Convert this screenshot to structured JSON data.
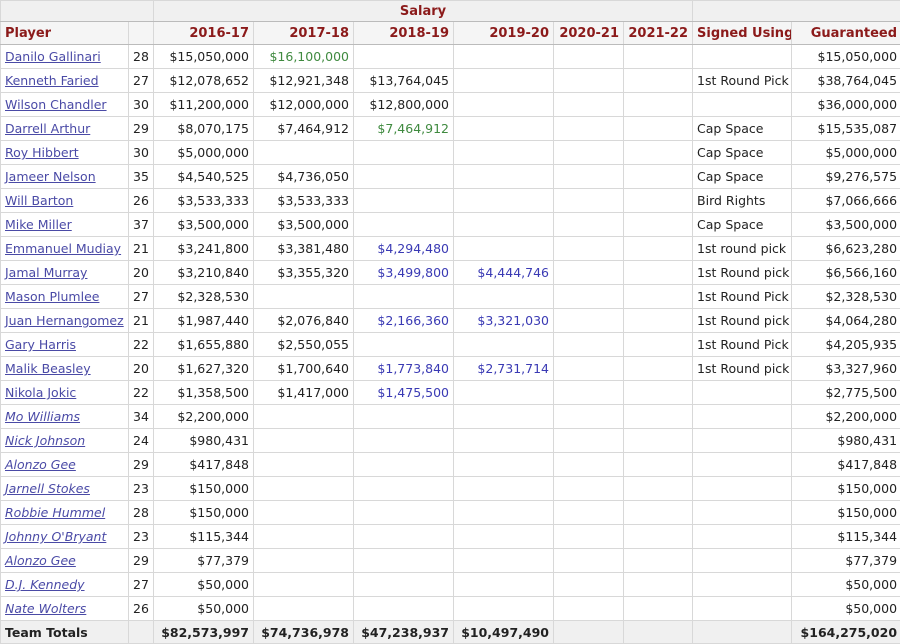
{
  "header": {
    "group_label": "Salary",
    "columns": [
      "Player",
      "",
      "2016-17",
      "2017-18",
      "2018-19",
      "2019-20",
      "2020-21",
      "2021-22",
      "Signed Using",
      "Guaranteed"
    ]
  },
  "colors": {
    "header_text": "#8b1a1a",
    "link": "#4a4aa6",
    "player_option": "#3f8a3f",
    "rookie_scale": "#3a3ab4"
  },
  "rows": [
    {
      "player": "Danilo Gallinari",
      "age": "28",
      "salaries": [
        "$15,050,000",
        "$16,100,000",
        "",
        "",
        "",
        ""
      ],
      "styles": [
        "",
        "g",
        "",
        "",
        "",
        ""
      ],
      "signed": "",
      "guaranteed": "$15,050,000",
      "waived": false
    },
    {
      "player": "Kenneth Faried",
      "age": "27",
      "salaries": [
        "$12,078,652",
        "$12,921,348",
        "$13,764,045",
        "",
        "",
        ""
      ],
      "styles": [
        "",
        "",
        "",
        "",
        "",
        ""
      ],
      "signed": "1st Round Pick",
      "guaranteed": "$38,764,045",
      "waived": false
    },
    {
      "player": "Wilson Chandler",
      "age": "30",
      "salaries": [
        "$11,200,000",
        "$12,000,000",
        "$12,800,000",
        "",
        "",
        ""
      ],
      "styles": [
        "",
        "",
        "",
        "",
        "",
        ""
      ],
      "signed": "",
      "guaranteed": "$36,000,000",
      "waived": false
    },
    {
      "player": "Darrell Arthur",
      "age": "29",
      "salaries": [
        "$8,070,175",
        "$7,464,912",
        "$7,464,912",
        "",
        "",
        ""
      ],
      "styles": [
        "",
        "",
        "g",
        "",
        "",
        ""
      ],
      "signed": "Cap Space",
      "guaranteed": "$15,535,087",
      "waived": false
    },
    {
      "player": "Roy Hibbert",
      "age": "30",
      "salaries": [
        "$5,000,000",
        "",
        "",
        "",
        "",
        ""
      ],
      "styles": [
        "",
        "",
        "",
        "",
        "",
        ""
      ],
      "signed": "Cap Space",
      "guaranteed": "$5,000,000",
      "waived": false
    },
    {
      "player": "Jameer Nelson",
      "age": "35",
      "salaries": [
        "$4,540,525",
        "$4,736,050",
        "",
        "",
        "",
        ""
      ],
      "styles": [
        "",
        "",
        "",
        "",
        "",
        ""
      ],
      "signed": "Cap Space",
      "guaranteed": "$9,276,575",
      "waived": false
    },
    {
      "player": "Will Barton",
      "age": "26",
      "salaries": [
        "$3,533,333",
        "$3,533,333",
        "",
        "",
        "",
        ""
      ],
      "styles": [
        "",
        "",
        "",
        "",
        "",
        ""
      ],
      "signed": "Bird Rights",
      "guaranteed": "$7,066,666",
      "waived": false
    },
    {
      "player": "Mike Miller",
      "age": "37",
      "salaries": [
        "$3,500,000",
        "$3,500,000",
        "",
        "",
        "",
        ""
      ],
      "styles": [
        "",
        "",
        "",
        "",
        "",
        ""
      ],
      "signed": "Cap Space",
      "guaranteed": "$3,500,000",
      "waived": false
    },
    {
      "player": "Emmanuel Mudiay",
      "age": "21",
      "salaries": [
        "$3,241,800",
        "$3,381,480",
        "$4,294,480",
        "",
        "",
        ""
      ],
      "styles": [
        "",
        "",
        "b",
        "",
        "",
        ""
      ],
      "signed": "1st round pick",
      "guaranteed": "$6,623,280",
      "waived": false
    },
    {
      "player": "Jamal Murray",
      "age": "20",
      "salaries": [
        "$3,210,840",
        "$3,355,320",
        "$3,499,800",
        "$4,444,746",
        "",
        ""
      ],
      "styles": [
        "",
        "",
        "b",
        "b",
        "",
        ""
      ],
      "signed": "1st Round pick",
      "guaranteed": "$6,566,160",
      "waived": false
    },
    {
      "player": "Mason Plumlee",
      "age": "27",
      "salaries": [
        "$2,328,530",
        "",
        "",
        "",
        "",
        ""
      ],
      "styles": [
        "",
        "",
        "",
        "",
        "",
        ""
      ],
      "signed": "1st Round Pick",
      "guaranteed": "$2,328,530",
      "waived": false
    },
    {
      "player": "Juan Hernangomez",
      "age": "21",
      "salaries": [
        "$1,987,440",
        "$2,076,840",
        "$2,166,360",
        "$3,321,030",
        "",
        ""
      ],
      "styles": [
        "",
        "",
        "b",
        "b",
        "",
        ""
      ],
      "signed": "1st Round pick",
      "guaranteed": "$4,064,280",
      "waived": false
    },
    {
      "player": "Gary Harris",
      "age": "22",
      "salaries": [
        "$1,655,880",
        "$2,550,055",
        "",
        "",
        "",
        ""
      ],
      "styles": [
        "",
        "",
        "",
        "",
        "",
        ""
      ],
      "signed": "1st Round Pick",
      "guaranteed": "$4,205,935",
      "waived": false
    },
    {
      "player": "Malik Beasley",
      "age": "20",
      "salaries": [
        "$1,627,320",
        "$1,700,640",
        "$1,773,840",
        "$2,731,714",
        "",
        ""
      ],
      "styles": [
        "",
        "",
        "b",
        "b",
        "",
        ""
      ],
      "signed": "1st Round pick",
      "guaranteed": "$3,327,960",
      "waived": false
    },
    {
      "player": "Nikola Jokic",
      "age": "22",
      "salaries": [
        "$1,358,500",
        "$1,417,000",
        "$1,475,500",
        "",
        "",
        ""
      ],
      "styles": [
        "",
        "",
        "b",
        "",
        "",
        ""
      ],
      "signed": "",
      "guaranteed": "$2,775,500",
      "waived": false
    },
    {
      "player": "Mo Williams",
      "age": "34",
      "salaries": [
        "$2,200,000",
        "",
        "",
        "",
        "",
        ""
      ],
      "styles": [
        "",
        "",
        "",
        "",
        "",
        ""
      ],
      "signed": "",
      "guaranteed": "$2,200,000",
      "waived": true
    },
    {
      "player": "Nick Johnson",
      "age": "24",
      "salaries": [
        "$980,431",
        "",
        "",
        "",
        "",
        ""
      ],
      "styles": [
        "",
        "",
        "",
        "",
        "",
        ""
      ],
      "signed": "",
      "guaranteed": "$980,431",
      "waived": true
    },
    {
      "player": "Alonzo Gee",
      "age": "29",
      "salaries": [
        "$417,848",
        "",
        "",
        "",
        "",
        ""
      ],
      "styles": [
        "",
        "",
        "",
        "",
        "",
        ""
      ],
      "signed": "",
      "guaranteed": "$417,848",
      "waived": true
    },
    {
      "player": "Jarnell Stokes",
      "age": "23",
      "salaries": [
        "$150,000",
        "",
        "",
        "",
        "",
        ""
      ],
      "styles": [
        "",
        "",
        "",
        "",
        "",
        ""
      ],
      "signed": "",
      "guaranteed": "$150,000",
      "waived": true
    },
    {
      "player": "Robbie Hummel",
      "age": "28",
      "salaries": [
        "$150,000",
        "",
        "",
        "",
        "",
        ""
      ],
      "styles": [
        "",
        "",
        "",
        "",
        "",
        ""
      ],
      "signed": "",
      "guaranteed": "$150,000",
      "waived": true
    },
    {
      "player": "Johnny O'Bryant",
      "age": "23",
      "salaries": [
        "$115,344",
        "",
        "",
        "",
        "",
        ""
      ],
      "styles": [
        "",
        "",
        "",
        "",
        "",
        ""
      ],
      "signed": "",
      "guaranteed": "$115,344",
      "waived": true
    },
    {
      "player": "Alonzo Gee",
      "age": "29",
      "salaries": [
        "$77,379",
        "",
        "",
        "",
        "",
        ""
      ],
      "styles": [
        "",
        "",
        "",
        "",
        "",
        ""
      ],
      "signed": "",
      "guaranteed": "$77,379",
      "waived": true
    },
    {
      "player": "D.J. Kennedy",
      "age": "27",
      "salaries": [
        "$50,000",
        "",
        "",
        "",
        "",
        ""
      ],
      "styles": [
        "",
        "",
        "",
        "",
        "",
        ""
      ],
      "signed": "",
      "guaranteed": "$50,000",
      "waived": true
    },
    {
      "player": "Nate Wolters",
      "age": "26",
      "salaries": [
        "$50,000",
        "",
        "",
        "",
        "",
        ""
      ],
      "styles": [
        "",
        "",
        "",
        "",
        "",
        ""
      ],
      "signed": "",
      "guaranteed": "$50,000",
      "waived": true
    }
  ],
  "totals": {
    "label": "Team Totals",
    "salaries": [
      "$82,573,997",
      "$74,736,978",
      "$47,238,937",
      "$10,497,490",
      "",
      ""
    ],
    "guaranteed": "$164,275,020"
  }
}
